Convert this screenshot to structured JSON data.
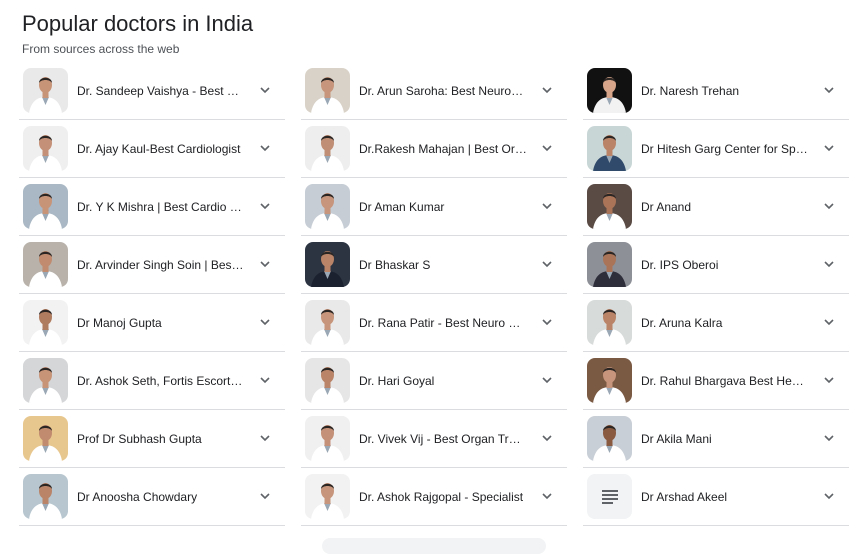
{
  "header": {
    "title": "Popular doctors in India",
    "subtitle": "From sources across the web"
  },
  "doctors": [
    {
      "name": "Dr. Sandeep Vaishya - Best Neurosurgeon",
      "thumb": "photo",
      "bg": "#e9e9e9",
      "coat": "#ffffff",
      "skin": "#c89478"
    },
    {
      "name": "Dr. Arun Saroha: Best Neurosurgeon",
      "thumb": "photo",
      "bg": "#d9d2c8",
      "coat": "#ffffff",
      "skin": "#c6957b"
    },
    {
      "name": "Dr. Naresh Trehan",
      "thumb": "photo",
      "bg": "#111111",
      "coat": "#f2f2f2",
      "skin": "#d6a58a"
    },
    {
      "name": "Dr. Ajay Kaul-Best Cardiologist",
      "thumb": "photo",
      "bg": "#efefef",
      "coat": "#ffffff",
      "skin": "#c49077"
    },
    {
      "name": "Dr.Rakesh Mahajan | Best Organ Transplant",
      "thumb": "photo",
      "bg": "#eeeeee",
      "coat": "#ffffff",
      "skin": "#bf8e74"
    },
    {
      "name": "Dr Hitesh Garg Center for Spine",
      "thumb": "photo",
      "bg": "#c9d6d6",
      "coat": "#2f4a6b",
      "skin": "#b98468"
    },
    {
      "name": "Dr. Y K Mishra | Best Cardio Surgeon",
      "thumb": "photo",
      "bg": "#a9b8c4",
      "coat": "#ffffff",
      "skin": "#c89478"
    },
    {
      "name": "Dr Aman Kumar",
      "thumb": "photo",
      "bg": "#c7cdd5",
      "coat": "#ffffff",
      "skin": "#c6957b"
    },
    {
      "name": "Dr Anand",
      "thumb": "photo",
      "bg": "#5a4b45",
      "coat": "#ffffff",
      "skin": "#a97458"
    },
    {
      "name": "Dr. Arvinder Singh Soin | Best Liver Surgeon",
      "thumb": "photo",
      "bg": "#b8b2ab",
      "coat": "#ffffff",
      "skin": "#c08b6f"
    },
    {
      "name": "Dr Bhaskar S",
      "thumb": "photo",
      "bg": "#2c3442",
      "coat": "#1c2130",
      "skin": "#b98468"
    },
    {
      "name": "Dr. IPS Oberoi",
      "thumb": "photo",
      "bg": "#8e9098",
      "coat": "#2e2e3a",
      "skin": "#a97458"
    },
    {
      "name": "Dr Manoj Gupta",
      "thumb": "photo",
      "bg": "#f2f2f2",
      "coat": "#ffffff",
      "skin": "#b07c60"
    },
    {
      "name": "Dr. Rana Patir - Best Neuro Surgeon",
      "thumb": "photo",
      "bg": "#e9e9e9",
      "coat": "#ffffff",
      "skin": "#c6957b"
    },
    {
      "name": "Dr. Aruna Kalra",
      "thumb": "photo",
      "bg": "#d7dbd9",
      "coat": "#ffffff",
      "skin": "#b98468"
    },
    {
      "name": "Dr. Ashok Seth, Fortis Escorts Heart",
      "thumb": "photo",
      "bg": "#d4d6d8",
      "coat": "#ffffff",
      "skin": "#c89478"
    },
    {
      "name": "Dr. Hari Goyal",
      "thumb": "photo",
      "bg": "#e6e6e6",
      "coat": "#ffffff",
      "skin": "#b98468"
    },
    {
      "name": "Dr. Rahul Bhargava Best Hematologist",
      "thumb": "photo",
      "bg": "#7b5a44",
      "coat": "#ffffff",
      "skin": "#c6957b"
    },
    {
      "name": "Prof Dr Subhash Gupta",
      "thumb": "photo",
      "bg": "#e8c78f",
      "coat": "#ffffff",
      "skin": "#c08b6f"
    },
    {
      "name": "Dr. Vivek Vij - Best Organ Transplant",
      "thumb": "photo",
      "bg": "#f0f0f0",
      "coat": "#ffffff",
      "skin": "#c49077"
    },
    {
      "name": "Dr Akila Mani",
      "thumb": "photo",
      "bg": "#c9cfd6",
      "coat": "#ffffff",
      "skin": "#8a5a40"
    },
    {
      "name": "Dr Anoosha Chowdary",
      "thumb": "photo",
      "bg": "#b7c6cf",
      "coat": "#ffffff",
      "skin": "#b98468"
    },
    {
      "name": "Dr. Ashok Rajgopal - Specialist",
      "thumb": "photo",
      "bg": "#f2f2f2",
      "coat": "#ffffff",
      "skin": "#c6957b"
    },
    {
      "name": "Dr Arshad Akeel",
      "thumb": "document",
      "bg": "#f1f3f4",
      "coat": "",
      "skin": ""
    }
  ]
}
